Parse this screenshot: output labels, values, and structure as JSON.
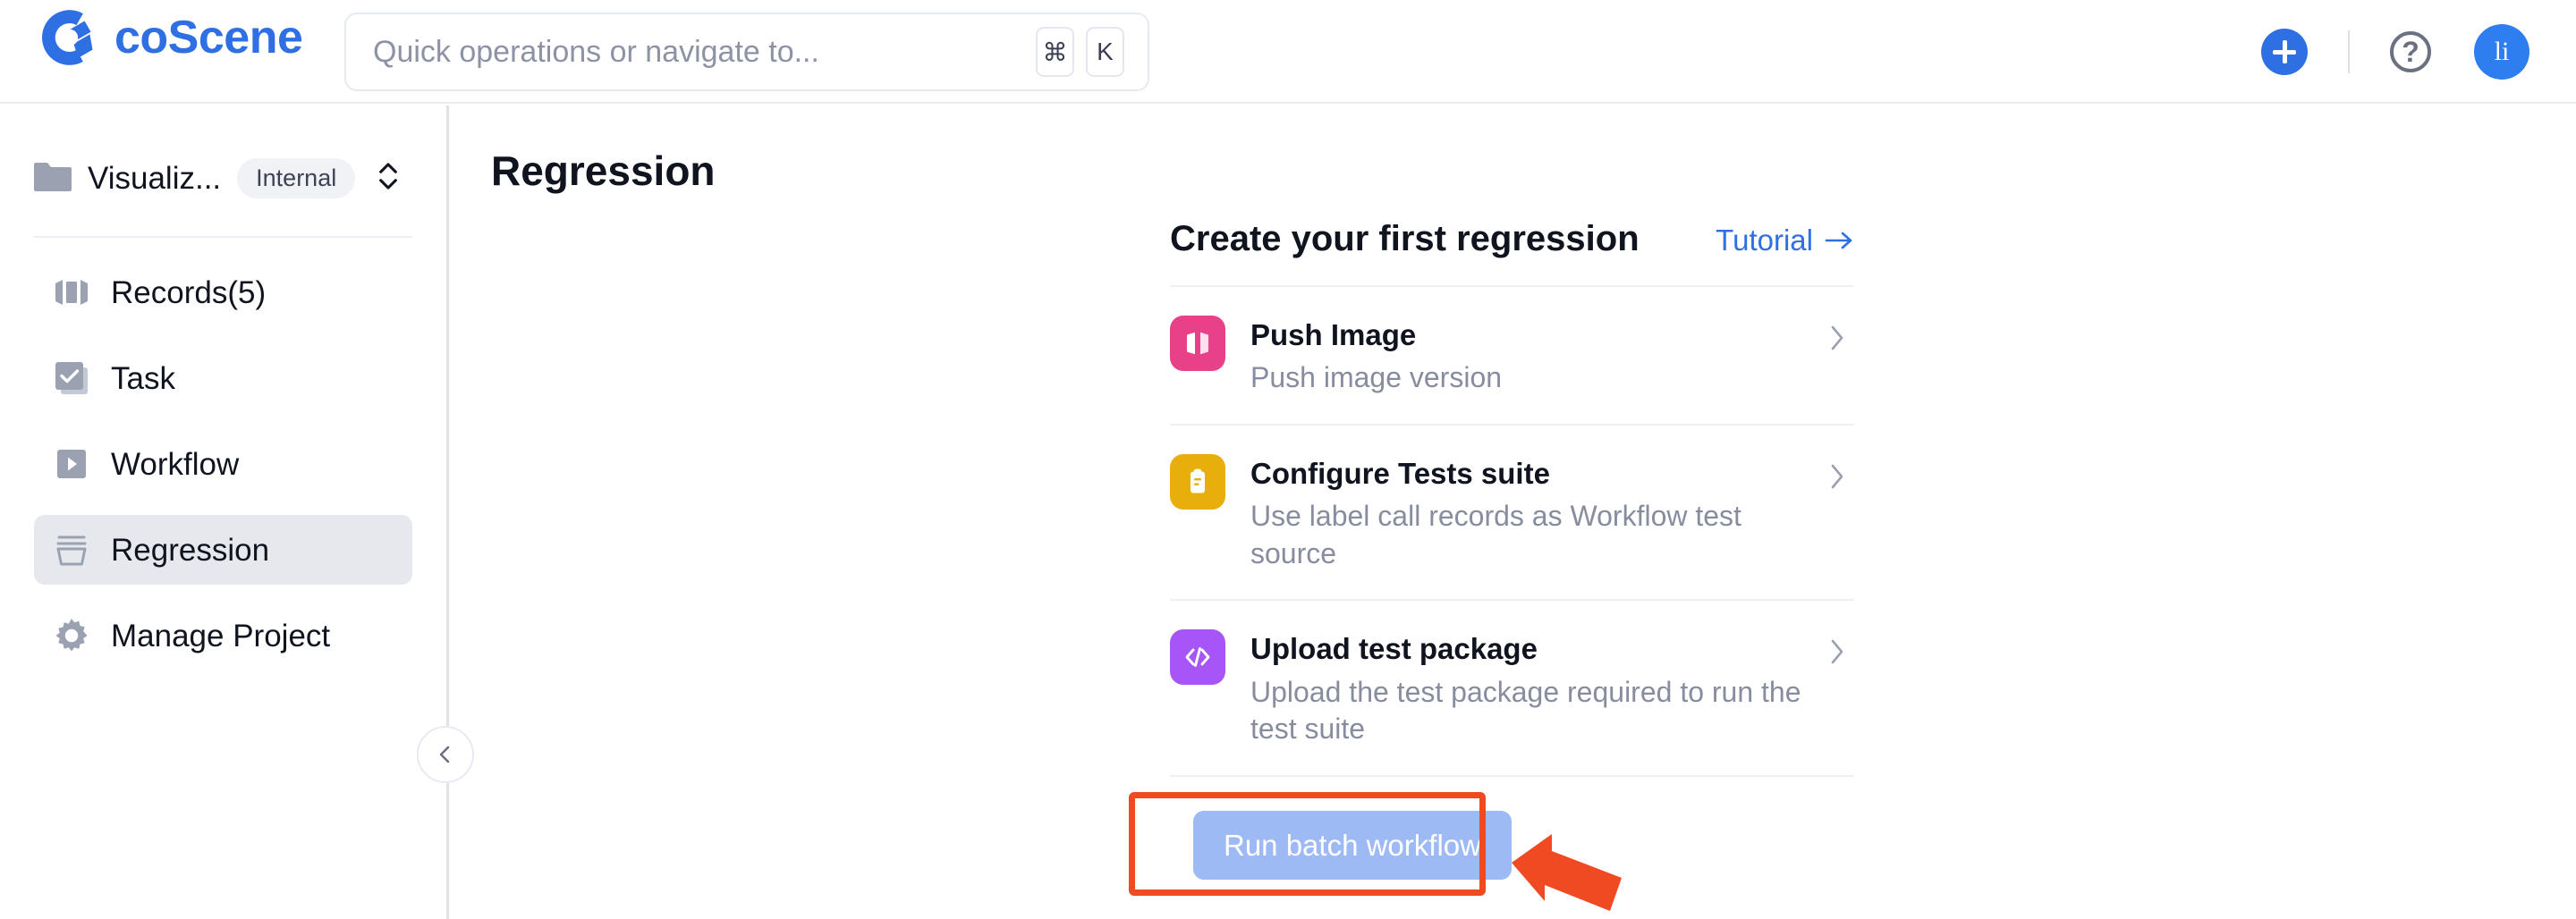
{
  "header": {
    "brand_name": "coScene",
    "logo_icon": "coscene-aperture-logo",
    "search": {
      "placeholder": "Quick operations or navigate to...",
      "kbd_modifier": "⌘",
      "kbd_key": "K"
    },
    "add_button_icon": "plus-icon",
    "help_button_label": "?",
    "avatar_initials": "li",
    "accent_color": "#2f6fe4"
  },
  "sidebar": {
    "project": {
      "icon": "folder-icon",
      "name": "Visualiz...",
      "badge": "Internal",
      "switch_icon": "chevron-up-down-icon"
    },
    "items": [
      {
        "label": "Records(5)",
        "icon": "records-icon",
        "active": false
      },
      {
        "label": "Task",
        "icon": "task-checkbox-icon",
        "active": false
      },
      {
        "label": "Workflow",
        "icon": "workflow-play-icon",
        "active": false
      },
      {
        "label": "Regression",
        "icon": "regression-bucket-icon",
        "active": true
      },
      {
        "label": "Manage Project",
        "icon": "gear-icon",
        "active": false
      }
    ],
    "collapse_icon": "chevron-left-icon"
  },
  "main": {
    "page_title": "Regression",
    "card": {
      "title": "Create your first regression",
      "tutorial_label": "Tutorial",
      "tutorial_icon": "arrow-right-icon",
      "options": [
        {
          "title": "Push Image",
          "description": "Push image version",
          "icon": "image-panels-icon",
          "icon_color": "#e8418a",
          "chevron_icon": "chevron-right-icon"
        },
        {
          "title": "Configure Tests suite",
          "description": "Use label call records as Workflow test source",
          "icon": "clipboard-icon",
          "icon_color": "#e8ae0c",
          "chevron_icon": "chevron-right-icon"
        },
        {
          "title": "Upload test package",
          "description": "Upload the test package required to run the test suite",
          "icon": "code-brackets-icon",
          "icon_color": "#a855f7",
          "chevron_icon": "chevron-right-icon"
        }
      ],
      "cta_label": "Run batch workflow",
      "cta_disabled_color": "#9dbaf5"
    }
  },
  "annotation": {
    "highlight_color": "#f04a23",
    "target": "Run batch workflow",
    "arrow_icon": "arrow-pointer-left-icon"
  }
}
